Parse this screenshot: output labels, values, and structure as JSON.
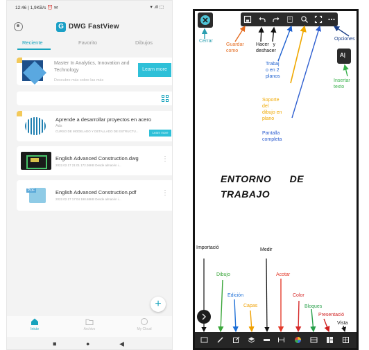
{
  "phone": {
    "status": {
      "time": "12:46 | 1,9KB/s ⏰ ✉",
      "signals": "▾ .ıll ⬚"
    },
    "app_title": "DWG FastView",
    "logo_letter": "G",
    "tabs": [
      {
        "label": "Reciente",
        "active": true
      },
      {
        "label": "Favorito",
        "active": false
      },
      {
        "label": "Dibujos",
        "active": false
      }
    ],
    "ad": {
      "text": "Master In Analytics, Innovation and Technology",
      "subtext": "Descubre más sobre las más",
      "button": "Learn more"
    },
    "promo": {
      "title": "Aprende a desarrollar proyectos en acero",
      "tag": "Ads",
      "subtitle": "CURSO DE MODELADO Y DETALLADO DE ESTRUCTU...",
      "button": "Learn more"
    },
    "files": [
      {
        "name": "English Advanced Construction.dwg",
        "meta": "2022.02.17 21:01  172.36KB  Desde almacén i...",
        "type": "dwg"
      },
      {
        "name": "English Advanced Construction.pdf",
        "meta": "2022.02.17 17:04  198.68KB  Desde almacén i...",
        "type": "pdf"
      }
    ],
    "fab_label": "+",
    "bottom_nav": [
      {
        "label": "Inicio",
        "active": true
      },
      {
        "label": "Archivo",
        "active": false
      },
      {
        "label": "My Cloud",
        "active": false
      }
    ],
    "system_nav": [
      "■",
      "●",
      "◀"
    ]
  },
  "screen": {
    "main_title_line1": "ENTORNO      DE",
    "main_title_line2": "TRABAJO",
    "annotations": {
      "cerrar": "Cerrar",
      "guardar": "Guardar\ncomo",
      "deshacer": "Hacer   y\ndeshacer",
      "trabajo": "Trabaj\no en 2\nplanos",
      "soporte": "Soporte\ndel\ndibujo en\nplano",
      "pantalla": "Pantalla\ncompleta",
      "opciones": "Opciones",
      "insertar": "Insertar\ntexto",
      "importacion": "Importació",
      "medir": "Medir",
      "dibujo": "Dibujo",
      "acotar": "Acotar",
      "edicion": "Edición",
      "capas": "Capas",
      "color": "Color",
      "bloques": "Bloques",
      "presentacion": "Presentació",
      "vista": "Vista"
    },
    "insert_text_icon": "A|",
    "colors": {
      "cerrar": "#2b9fb0",
      "guardar": "#e46a1e",
      "deshacer": "#111111",
      "trabajo": "#1c5fcf",
      "soporte": "#f0a800",
      "pantalla": "#2f5fd0",
      "opciones": "#1b3f88",
      "insertar": "#38b04a",
      "importacion": "#111111",
      "medir": "#111111",
      "dibujo": "#3aa63a",
      "acotar": "#e33b2b",
      "edicion": "#1d6fd6",
      "capas": "#f0a000",
      "color": "#d62b2b",
      "bloques": "#28a04a",
      "presentacion": "#d02020",
      "vista": "#111111"
    }
  }
}
